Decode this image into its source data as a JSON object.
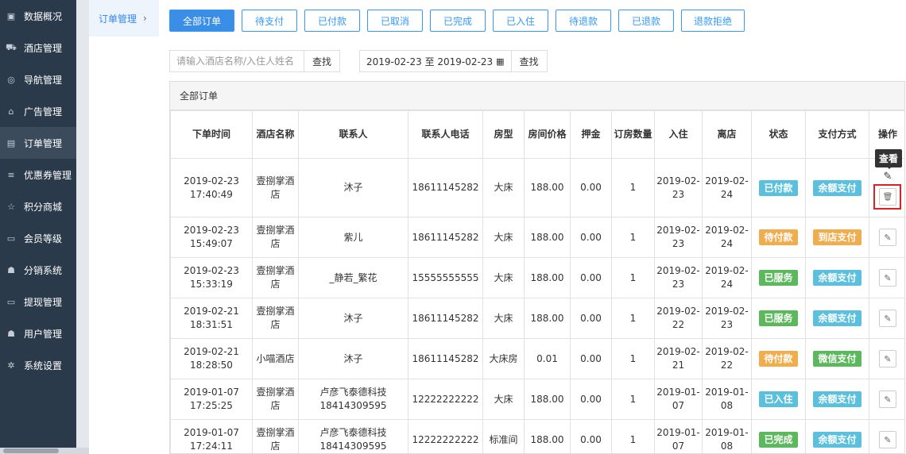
{
  "sidebar": {
    "items": [
      {
        "label": "数据概况",
        "icon": "dashboard-icon",
        "glyph": "▣"
      },
      {
        "label": "酒店管理",
        "icon": "cart-icon",
        "glyph": "⛟"
      },
      {
        "label": "导航管理",
        "icon": "compass-icon",
        "glyph": "◎"
      },
      {
        "label": "广告管理",
        "icon": "gift-icon",
        "glyph": "⌂"
      },
      {
        "label": "订单管理",
        "icon": "list-icon",
        "glyph": "▤"
      },
      {
        "label": "优惠券管理",
        "icon": "menu-icon",
        "glyph": "≡"
      },
      {
        "label": "积分商城",
        "icon": "star-icon",
        "glyph": "☆"
      },
      {
        "label": "会员等级",
        "icon": "card-icon",
        "glyph": "▭"
      },
      {
        "label": "分销系统",
        "icon": "users-icon",
        "glyph": "☗"
      },
      {
        "label": "提现管理",
        "icon": "money-icon",
        "glyph": "▭"
      },
      {
        "label": "用户管理",
        "icon": "user-icon",
        "glyph": "☗"
      },
      {
        "label": "系统设置",
        "icon": "gear-icon",
        "glyph": "✲"
      }
    ]
  },
  "submenu": {
    "label": "订单管理",
    "chevron": "›"
  },
  "filters": [
    "全部订单",
    "待支付",
    "已付款",
    "已取消",
    "已完成",
    "已入住",
    "待退款",
    "已退款",
    "退款拒绝"
  ],
  "search": {
    "placeholder": "请输入酒店名称/入住人姓名",
    "button": "查找",
    "date_range": "2019-02-23 至 2019-02-23",
    "date_button": "查找"
  },
  "panel": {
    "title": "全部订单"
  },
  "table": {
    "headers": [
      "下单时间",
      "酒店名称",
      "联系人",
      "联系人电话",
      "房型",
      "房间价格",
      "押金",
      "订房数量",
      "入住",
      "离店",
      "状态",
      "支付方式",
      "操作"
    ],
    "rows": [
      {
        "time": "2019-02-23 17:40:49",
        "hotel": "壹捌掌酒店",
        "contact": "沐子",
        "phone": "18611145282",
        "room": "大床",
        "price": "188.00",
        "deposit": "0.00",
        "qty": "1",
        "checkin": "2019-02-23",
        "checkout": "2019-02-24",
        "status": "已付款",
        "status_color": "blue",
        "pay": "余额支付",
        "pay_color": "blue"
      },
      {
        "time": "2019-02-23 15:49:07",
        "hotel": "壹捌掌酒店",
        "contact": "紫儿",
        "phone": "18611145282",
        "room": "大床",
        "price": "188.00",
        "deposit": "0.00",
        "qty": "1",
        "checkin": "2019-02-23",
        "checkout": "2019-02-24",
        "status": "待付款",
        "status_color": "orange",
        "pay": "到店支付",
        "pay_color": "orange"
      },
      {
        "time": "2019-02-23 15:33:19",
        "hotel": "壹捌掌酒店",
        "contact": "_静若_繁花",
        "phone": "15555555555",
        "room": "大床",
        "price": "188.00",
        "deposit": "0.00",
        "qty": "1",
        "checkin": "2019-02-23",
        "checkout": "2019-02-24",
        "status": "已服务",
        "status_color": "green",
        "pay": "余额支付",
        "pay_color": "blue"
      },
      {
        "time": "2019-02-21 18:31:51",
        "hotel": "壹捌掌酒店",
        "contact": "沐子",
        "phone": "18611145282",
        "room": "大床",
        "price": "188.00",
        "deposit": "0.00",
        "qty": "1",
        "checkin": "2019-02-22",
        "checkout": "2019-02-23",
        "status": "已服务",
        "status_color": "green",
        "pay": "余额支付",
        "pay_color": "blue"
      },
      {
        "time": "2019-02-21 18:28:50",
        "hotel": "小喵酒店",
        "contact": "沐子",
        "phone": "18611145282",
        "room": "大床房",
        "price": "0.01",
        "deposit": "0.00",
        "qty": "1",
        "checkin": "2019-02-21",
        "checkout": "2019-02-22",
        "status": "待付款",
        "status_color": "orange",
        "pay": "微信支付",
        "pay_color": "green"
      },
      {
        "time": "2019-01-07 17:25:25",
        "hotel": "壹捌掌酒店",
        "contact": "卢彦飞泰德科技 18414309595",
        "phone": "12222222222",
        "room": "大床",
        "price": "188.00",
        "deposit": "0.00",
        "qty": "1",
        "checkin": "2019-01-07",
        "checkout": "2019-01-08",
        "status": "已入住",
        "status_color": "blue",
        "pay": "余额支付",
        "pay_color": "blue"
      },
      {
        "time": "2019-01-07 17:24:11",
        "hotel": "壹捌掌酒店",
        "contact": "卢彦飞泰德科技 18414309595",
        "phone": "12222222222",
        "room": "标准间",
        "price": "188.00",
        "deposit": "0.00",
        "qty": "1",
        "checkin": "2019-01-07",
        "checkout": "2019-01-08",
        "status": "已完成",
        "status_color": "green",
        "pay": "余额支付",
        "pay_color": "blue"
      }
    ]
  },
  "tooltip": {
    "text": "查看"
  },
  "colors": {
    "primary": "#3a8ee6",
    "sidebar_bg": "#2b3a4a",
    "badge_blue": "#5bc0de",
    "badge_orange": "#f0ad4e",
    "badge_green": "#5cb85c",
    "highlight_red": "#e02020"
  }
}
